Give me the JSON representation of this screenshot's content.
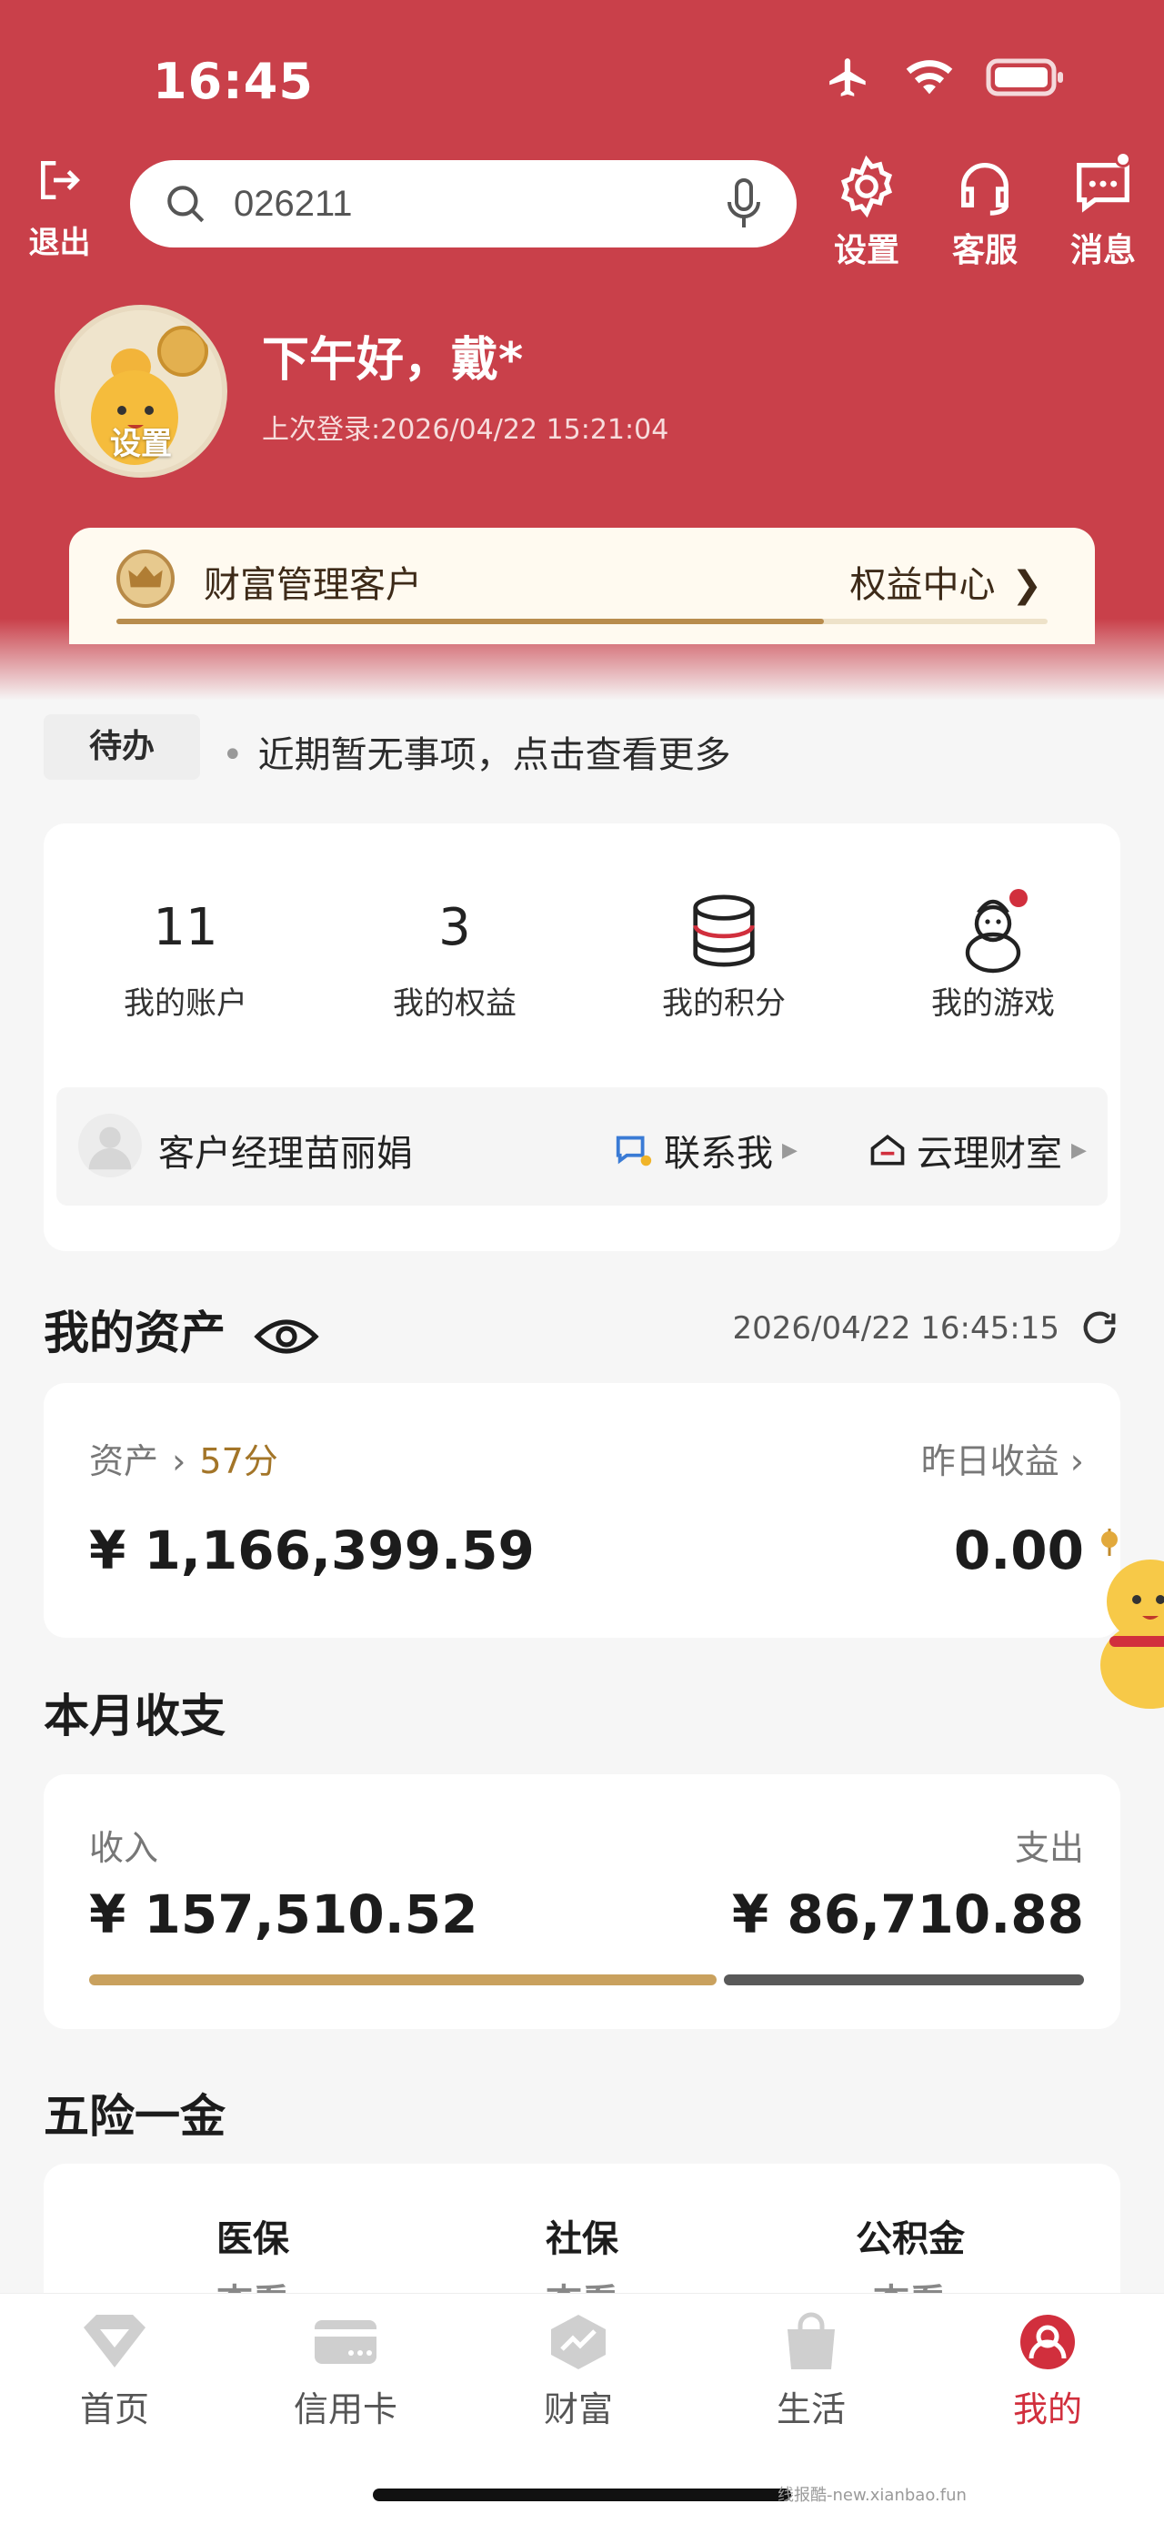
{
  "statusbar": {
    "time": "16:45",
    "icons": [
      "airplane-icon",
      "wifi-icon",
      "battery-icon"
    ]
  },
  "topbar": {
    "logout_label": "退出",
    "search": {
      "value": "026211"
    },
    "actions": [
      {
        "label": "设置",
        "icon": "gear-icon"
      },
      {
        "label": "客服",
        "icon": "headset-icon"
      },
      {
        "label": "消息",
        "icon": "message-icon"
      }
    ]
  },
  "profile": {
    "avatar_label": "设置",
    "greeting": "下午好，戴*",
    "last_login": "上次登录:2026/04/22 15:21:04"
  },
  "wealth": {
    "label": "财富管理客户",
    "link": "权益中心",
    "progress": 0.76
  },
  "todo": {
    "badge": "待办",
    "text": "近期暂无事项，点击查看更多"
  },
  "quick": {
    "items": [
      {
        "value": "11",
        "label": "我的账户"
      },
      {
        "value": "3",
        "label": "我的权益"
      },
      {
        "label": "我的积分",
        "icon": "coins-icon"
      },
      {
        "label": "我的游戏",
        "icon": "snowman-icon"
      }
    ],
    "manager": {
      "name": "客户经理苗丽娟",
      "contact": "联系我",
      "office": "云理财室"
    }
  },
  "assets": {
    "title": "我的资产",
    "timestamp": "2026/04/22 16:45:15",
    "asset_label": "资产",
    "score": "57分",
    "yesterday_label": "昨日收益",
    "total": "¥ 1,166,399.59",
    "yesterday_value": "0.00"
  },
  "monthly": {
    "title": "本月收支",
    "income_label": "收入",
    "expense_label": "支出",
    "income": "¥ 157,510.52",
    "expense": "¥ 86,710.88",
    "colors": {
      "income": "#c9a15e",
      "expense": "#595959"
    }
  },
  "insurance": {
    "title": "五险一金",
    "items": [
      "医保",
      "社保",
      "公积金"
    ],
    "sub": "查看"
  },
  "tabbar": {
    "tabs": [
      {
        "label": "首页",
        "icon": "diamond-icon"
      },
      {
        "label": "信用卡",
        "icon": "credit-card-icon"
      },
      {
        "label": "财富",
        "icon": "wealth-icon"
      },
      {
        "label": "生活",
        "icon": "shopping-bag-icon"
      },
      {
        "label": "我的",
        "icon": "profile-icon",
        "active": true
      }
    ]
  },
  "watermark": "线报酷-new.xianbao.fun",
  "colors": {
    "header": "#c9404a",
    "accent_red": "#d12f3d",
    "gold": "#b88c4d"
  }
}
